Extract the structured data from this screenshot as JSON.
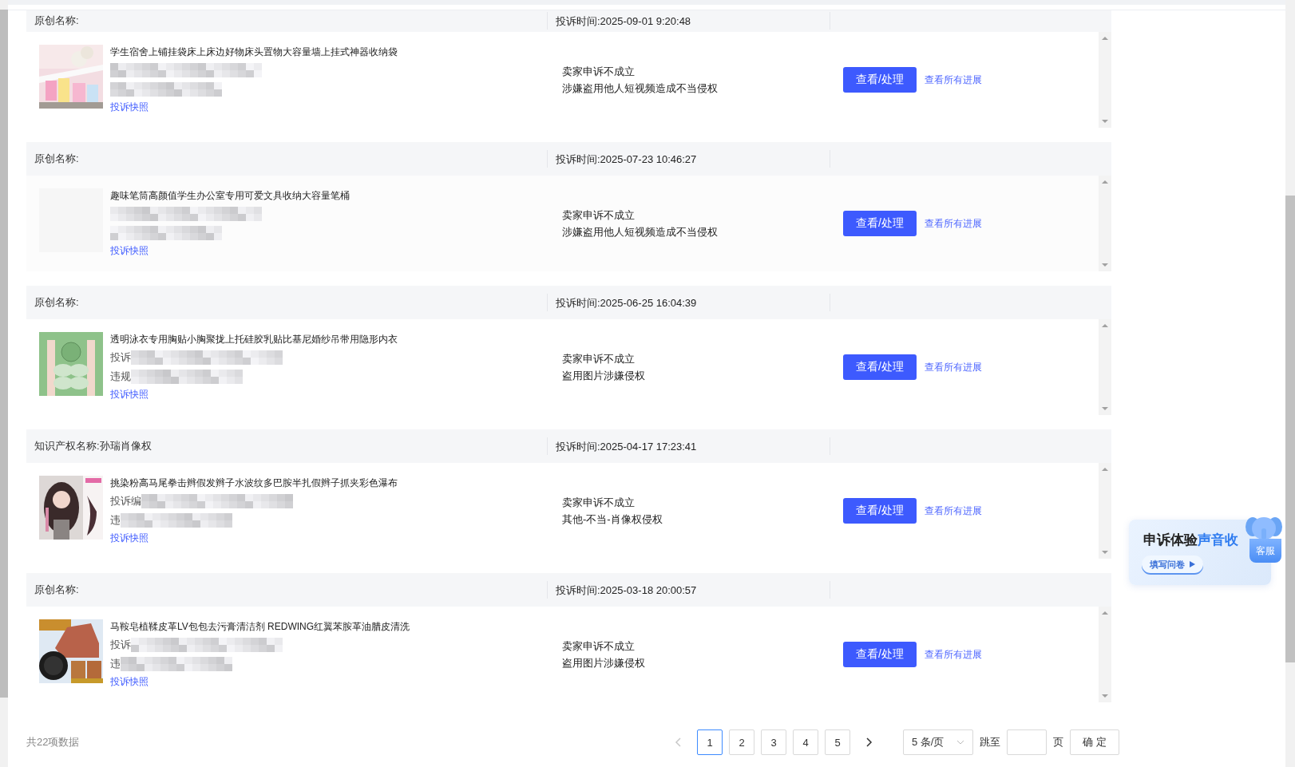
{
  "records": [
    {
      "header_label": "原创名称:",
      "complaint_time": "投诉时间:2025-09-01 9:20:48",
      "title": "学生宿舍上铺挂袋床上床边好物床头置物大容量墙上挂式神器收纳袋",
      "snapshot_link": "投诉快照",
      "status": "卖家申诉不成立",
      "reason": "涉嫌盗用他人短视频造成不当侵权",
      "action_button": "查看/处理",
      "progress_link": "查看所有进展"
    },
    {
      "header_label": "原创名称:",
      "complaint_time": "投诉时间:2025-07-23 10:46:27",
      "thumbnail": {
        "kind": "blank"
      },
      "title": "趣味笔筒高颜值学生办公室专用可爱文具收纳大容量笔桶",
      "snapshot_link": "投诉快照",
      "status": "卖家申诉不成立",
      "reason": "涉嫌盗用他人短视频造成不当侵权",
      "action_button": "查看/处理",
      "progress_link": "查看所有进展"
    },
    {
      "header_label": "原创名称:",
      "complaint_time": "投诉时间:2025-06-25 16:04:39",
      "title": "透明泳衣专用胸贴小胸聚拢上托硅胶乳贴比基尼婚纱吊带用隐形内衣",
      "masked_prefixes": [
        "投诉",
        "违规"
      ],
      "snapshot_link": "投诉快照",
      "status": "卖家申诉不成立",
      "reason": "盗用图片涉嫌侵权",
      "action_button": "查看/处理",
      "progress_link": "查看所有进展"
    },
    {
      "header_label": "知识产权名称:孙瑞肖像权",
      "complaint_time": "投诉时间:2025-04-17 17:23:41",
      "title": "挑染粉高马尾拳击辫假发辫子水波纹多巴胺半扎假辫子抓夹彩色瀑布",
      "masked_prefixes": [
        "投诉编",
        "违"
      ],
      "snapshot_link": "投诉快照",
      "status": "卖家申诉不成立",
      "reason": "其他-不当-肖像权侵权",
      "action_button": "查看/处理",
      "progress_link": "查看所有进展"
    },
    {
      "header_label": "原创名称:",
      "complaint_time": "投诉时间:2025-03-18 20:00:57",
      "title": "马鞍皂植鞣皮革LV包包去污膏清洁剂 REDWING红翼苯胺革油腊皮清洗",
      "masked_prefixes": [
        "投诉",
        "违"
      ],
      "snapshot_link": "投诉快照",
      "status": "卖家申诉不成立",
      "reason": "盗用图片涉嫌侵权",
      "action_button": "查看/处理",
      "progress_link": "查看所有进展"
    }
  ],
  "footer": {
    "total": "共22项数据",
    "pages": [
      {
        "label": "1",
        "selected": true
      },
      {
        "label": "2",
        "selected": false
      },
      {
        "label": "3",
        "selected": false
      },
      {
        "label": "4",
        "selected": false
      },
      {
        "label": "5",
        "selected": false
      }
    ],
    "prev_disabled": true,
    "page_size": "5 条/页",
    "jump_label": "跳至",
    "page_unit": "页",
    "confirm_button": "确 定"
  },
  "survey_widget": {
    "title_dark": "申诉体验",
    "title_blue": "声音收",
    "button": "填写问卷",
    "service_label": "客服"
  }
}
